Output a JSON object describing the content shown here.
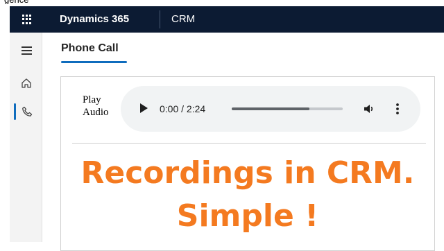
{
  "top_cutoff_text": "gence",
  "topbar": {
    "app_name": "Dynamics 365",
    "module": "CRM"
  },
  "sidebar": {
    "items": [
      {
        "icon": "hamburger-icon"
      },
      {
        "icon": "home-icon"
      },
      {
        "icon": "phone-icon",
        "selected": true
      }
    ]
  },
  "tab": {
    "label": "Phone Call"
  },
  "audio": {
    "label_line1": "Play",
    "label_line2": "Audio",
    "current_time": "0:00",
    "duration": "2:24",
    "time_text": "0:00 / 2:24",
    "progress_fraction": 0.7
  },
  "content": {
    "line1": "Recordings in CRM.",
    "line2": "Simple !"
  },
  "colors": {
    "topbar": "#0c1b33",
    "accent": "#0f6cbd",
    "headline": "#f47a20",
    "player_bg": "#f1f3f4"
  }
}
